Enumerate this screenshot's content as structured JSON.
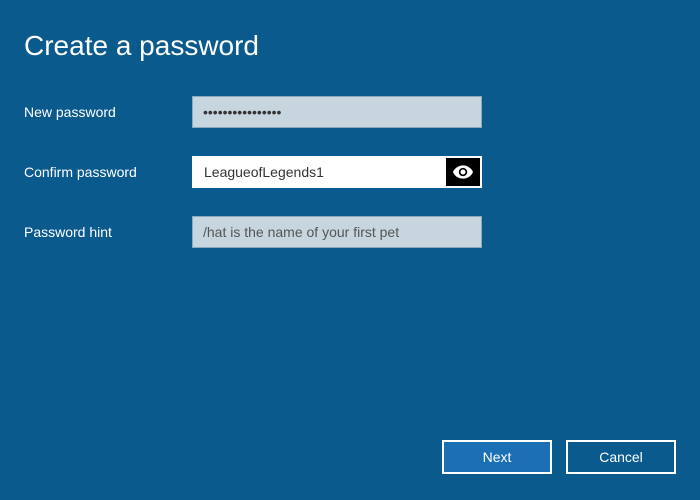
{
  "title": "Create a password",
  "fields": {
    "new_password": {
      "label": "New password",
      "value": "••••••••••••••••"
    },
    "confirm_password": {
      "label": "Confirm password",
      "value": "LeagueofLegends1"
    },
    "password_hint": {
      "label": "Password hint",
      "value": "/hat is the name of your first pet"
    }
  },
  "buttons": {
    "next": "Next",
    "cancel": "Cancel"
  }
}
